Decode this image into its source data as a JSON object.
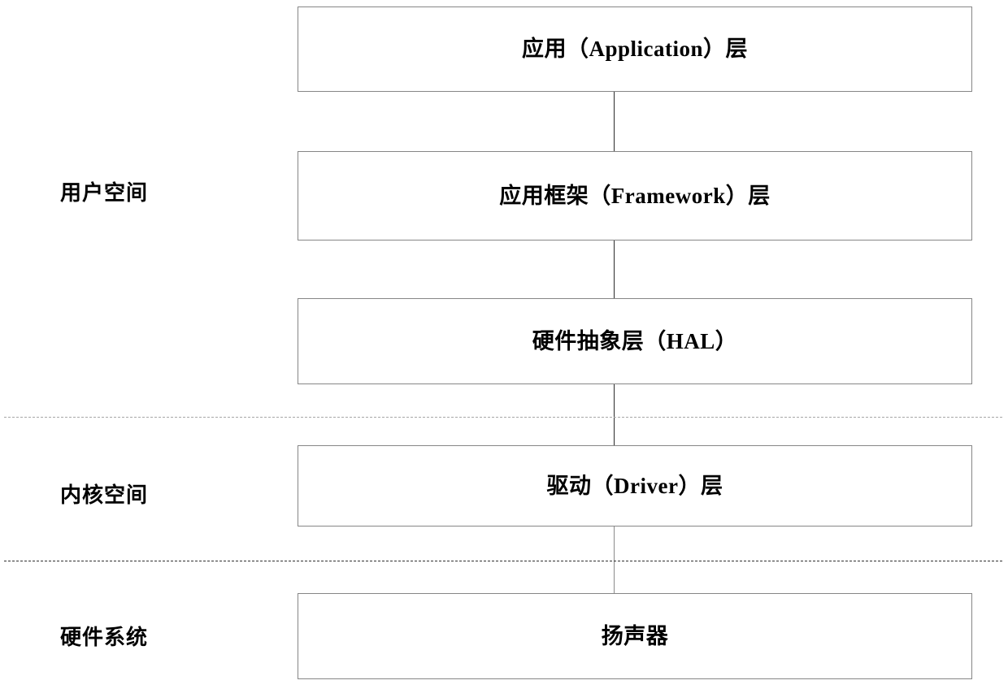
{
  "diagram": {
    "title": "Audio software stack layer diagram",
    "boxes": [
      {
        "id": "application",
        "label": "应用（Application）层"
      },
      {
        "id": "framework",
        "label": "应用框架（Framework）层"
      },
      {
        "id": "hal",
        "label": "硬件抽象层（HAL）"
      },
      {
        "id": "driver",
        "label": "驱动（Driver）层"
      },
      {
        "id": "speaker",
        "label": "扬声器"
      }
    ],
    "space_labels": [
      {
        "id": "user-space",
        "label": "用户空间"
      },
      {
        "id": "kernel-space",
        "label": "内核空间"
      },
      {
        "id": "hardware-system",
        "label": "硬件系统"
      }
    ],
    "colors": {
      "background": "#ffffff",
      "box_border": "#868686",
      "text": "#000000",
      "connector": "#2b2b2b",
      "connector_faint": "#8a8a8a",
      "divider_light": "#a6a6a6",
      "divider_dark": "#2f2f2f"
    }
  }
}
